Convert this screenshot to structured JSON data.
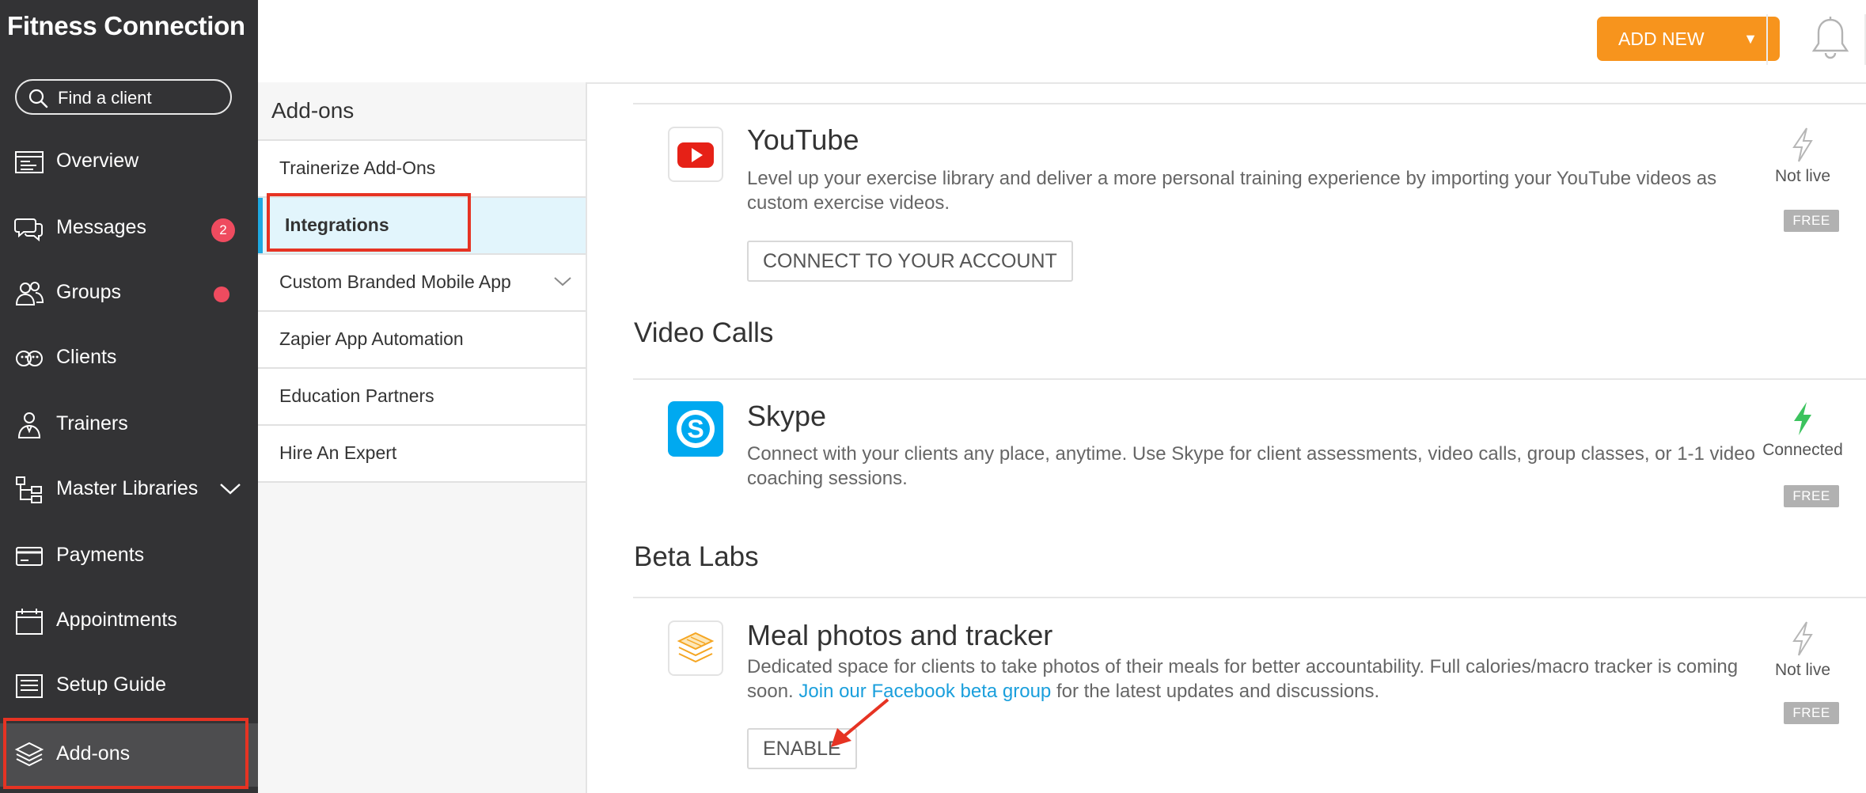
{
  "app": {
    "brand": "Fitness Connection"
  },
  "search": {
    "placeholder": "Find a client"
  },
  "nav": {
    "overview": "Overview",
    "messages": "Messages",
    "messages_badge": "2",
    "groups": "Groups",
    "clients": "Clients",
    "trainers": "Trainers",
    "master_libraries": "Master Libraries",
    "payments": "Payments",
    "appointments": "Appointments",
    "setup_guide": "Setup Guide",
    "addons": "Add-ons"
  },
  "header": {
    "add_new": "ADD NEW",
    "add_new_caret": "▼"
  },
  "addons_menu": {
    "title": "Add-ons",
    "items": [
      {
        "label": "Trainerize Add-Ons"
      },
      {
        "label": "Integrations"
      },
      {
        "label": "Custom Branded Mobile App"
      },
      {
        "label": "Zapier App Automation"
      },
      {
        "label": "Education Partners"
      },
      {
        "label": "Hire An Expert"
      }
    ]
  },
  "sections": {
    "video_calls": "Video Calls",
    "beta_labs": "Beta Labs"
  },
  "integrations": {
    "youtube": {
      "name": "YouTube",
      "desc": "Level up your exercise library and deliver a more personal training experience by importing your YouTube videos as custom exercise videos.",
      "button": "CONNECT TO YOUR ACCOUNT",
      "status": "Not live",
      "price": "FREE"
    },
    "skype": {
      "name": "Skype",
      "desc": "Connect with your clients any place, anytime. Use Skype for client assessments, video calls, group classes, or 1-1 video coaching sessions.",
      "status": "Connected",
      "price": "FREE"
    },
    "meal": {
      "name": "Meal photos and tracker",
      "desc_before": "Dedicated space for clients to take photos of their meals for better accountability. Full calories/macro tracker is coming soon. ",
      "desc_link": "Join our Facebook beta group",
      "desc_after": " for the latest updates and discussions.",
      "button": "ENABLE",
      "status": "Not live",
      "price": "FREE"
    }
  },
  "colors": {
    "sidebar_bg": "#333335",
    "accent_orange": "#f7941d",
    "badge_red": "#ef4b5f",
    "active_blue": "#1fa9e1",
    "connected_green": "#3cc35e",
    "highlight_red": "#e63323"
  }
}
